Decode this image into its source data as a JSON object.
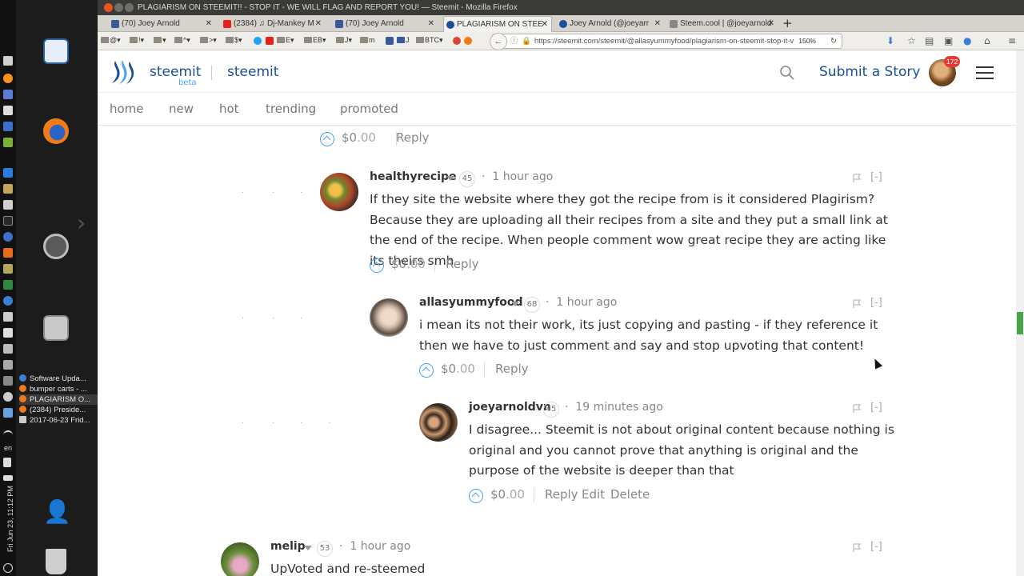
{
  "system_panel": {
    "clock": "Fri Jun 23, 11:12 PM",
    "language": "en",
    "window_list": [
      {
        "label": "Software Upda...",
        "active": false
      },
      {
        "label": "bumper carts - ...",
        "active": false
      },
      {
        "label": "PLAGIARISM O...",
        "active": true
      },
      {
        "label": "(2384) Preside...",
        "active": false
      },
      {
        "label": "2017-06-23 Frid...",
        "active": false
      }
    ]
  },
  "window": {
    "title": "PLAGIARISM ON STEEMIT!! - STOP IT - WE WILL FLAG AND REPORT YOU! — Steemit - Mozilla Firefox"
  },
  "tabs": [
    {
      "label": "(70) Joey Arnold",
      "icon": "facebook-icon",
      "color": "#3b5998"
    },
    {
      "label": "(2384) ♫ Dj-Mankey M",
      "icon": "youtube-icon",
      "color": "#e62117"
    },
    {
      "label": "(70) Joey Arnold",
      "icon": "facebook-icon",
      "color": "#3b5998"
    },
    {
      "label": "PLAGIARISM ON STEE",
      "icon": "steemit-icon",
      "color": "#1a5099"
    },
    {
      "label": "Joey Arnold (@joeyarr",
      "icon": "steemit-icon",
      "color": "#1a5099"
    },
    {
      "label": "Steem.cool | @joeyarnold",
      "icon": "page-icon",
      "color": "#888888"
    }
  ],
  "bookmarks": [
    "@",
    "!",
    "^",
    ">",
    "$",
    "E",
    "EB",
    "J",
    "m",
    "J",
    "BTC"
  ],
  "urlbar": {
    "url": "https://steemit.com/steemit/@allasyummyfood/plagiarism-on-steemit-stop-it-v",
    "zoom": "150%"
  },
  "site": {
    "brand": "steemit",
    "beta": "beta",
    "section": "steemit",
    "submit_label": "Submit a Story",
    "notification_count": "172",
    "nav": [
      "home",
      "new",
      "hot",
      "trending",
      "promoted"
    ]
  },
  "comments": [
    {
      "author": "",
      "rep": "",
      "time": "",
      "body": "",
      "payout": "$0",
      "payout_cents": ".00",
      "actions": [
        "Reply"
      ]
    },
    {
      "author": "healthyrecipe",
      "rep": "45",
      "time": "1 hour ago",
      "body": "If they site the website where they got the recipe from is it considered Plagirism? Because they are uploading all their recipes from a site and they put a small link at the end of the recipe. When people comment wow great recipe they are acting like its theirs smh",
      "payout": "$0",
      "payout_cents": ".00",
      "actions": [
        "Reply"
      ]
    },
    {
      "author": "allasyummyfood",
      "rep": "68",
      "time": "1 hour ago",
      "body": "i mean its not their work, its just copying and pasting - if they reference it then we have to just comment and say and stop upvoting that content!",
      "payout": "$0",
      "payout_cents": ".00",
      "actions": [
        "Reply"
      ]
    },
    {
      "author": "joeyarnoldvn",
      "rep": "45",
      "time": "19 minutes ago",
      "body": "I disagree... Steemit is not about original content because nothing is original and you cannot prove that anything is original and the purpose of the website is deeper than that",
      "payout": "$0",
      "payout_cents": ".00",
      "actions": [
        "Reply",
        "Edit",
        "Delete"
      ]
    },
    {
      "author": "melip",
      "rep": "53",
      "time": "1 hour ago",
      "body": "UpVoted and re-steemed",
      "payout": "",
      "payout_cents": "",
      "actions": []
    }
  ],
  "collapse_label": "[-]"
}
